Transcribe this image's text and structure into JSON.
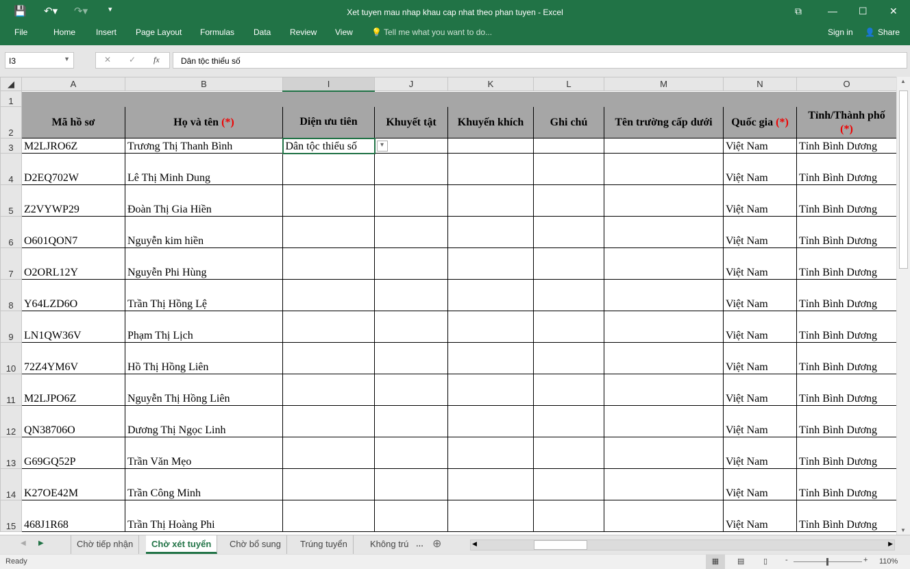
{
  "window": {
    "title": "Xet tuyen mau nhap khau cap nhat theo phan tuyen - Excel",
    "sign_in": "Sign in",
    "share": "Share"
  },
  "ribbon": {
    "tabs": [
      "File",
      "Home",
      "Insert",
      "Page Layout",
      "Formulas",
      "Data",
      "Review",
      "View"
    ],
    "tell_me": "Tell me what you want to do..."
  },
  "formula_bar": {
    "name_box": "I3",
    "fx": "fx",
    "value": "Dân tộc thiểu số"
  },
  "columns": [
    "A",
    "B",
    "I",
    "J",
    "K",
    "L",
    "M",
    "N",
    "O"
  ],
  "headers": {
    "a": "Mã hồ sơ",
    "b": "Họ và tên",
    "i": "Diện ưu tiên",
    "j": "Khuyết tật",
    "k": "Khuyến khích",
    "l": "Ghi chú",
    "m": "Tên trường cấp dưới",
    "n": "Quốc gia",
    "o": "Tỉnh/Thành phố",
    "star": "(*)"
  },
  "rows": [
    {
      "n": "3",
      "a": "M2LJRO6Z",
      "b": "Trương Thị Thanh Bình",
      "i": "Dân tộc thiểu số",
      "nat": "Việt Nam",
      "prov": "Tỉnh Bình Dương"
    },
    {
      "n": "4",
      "a": "D2EQ702W",
      "b": "Lê Thị Minh Dung",
      "i": "",
      "nat": "Việt Nam",
      "prov": "Tỉnh Bình Dương"
    },
    {
      "n": "5",
      "a": "Z2VYWP29",
      "b": "Đoàn Thị Gia Hiền",
      "i": "",
      "nat": "Việt Nam",
      "prov": "Tỉnh Bình Dương"
    },
    {
      "n": "6",
      "a": "O601QON7",
      "b": "Nguyễn kim hiền",
      "i": "",
      "nat": "Việt Nam",
      "prov": "Tỉnh Bình Dương"
    },
    {
      "n": "7",
      "a": "O2ORL12Y",
      "b": "Nguyễn Phi Hùng",
      "i": "",
      "nat": "Việt Nam",
      "prov": "Tỉnh Bình Dương"
    },
    {
      "n": "8",
      "a": "Y64LZD6O",
      "b": "Trần Thị Hồng Lệ",
      "i": "",
      "nat": "Việt Nam",
      "prov": "Tỉnh Bình Dương"
    },
    {
      "n": "9",
      "a": "LN1QW36V",
      "b": "Phạm Thị Lịch",
      "i": "",
      "nat": "Việt Nam",
      "prov": "Tỉnh Bình Dương"
    },
    {
      "n": "10",
      "a": "72Z4YM6V",
      "b": "Hồ Thị Hồng Liên",
      "i": "",
      "nat": "Việt Nam",
      "prov": "Tỉnh Bình Dương"
    },
    {
      "n": "11",
      "a": "M2LJPO6Z",
      "b": "Nguyễn Thị Hồng Liên",
      "i": "",
      "nat": "Việt Nam",
      "prov": "Tỉnh Bình Dương"
    },
    {
      "n": "12",
      "a": "QN38706O",
      "b": "Dương Thị Ngọc Linh",
      "i": "",
      "nat": "Việt Nam",
      "prov": "Tỉnh Bình Dương"
    },
    {
      "n": "13",
      "a": "G69GQ52P",
      "b": "Trần Văn Mẹo",
      "i": "",
      "nat": "Việt Nam",
      "prov": "Tỉnh Bình Dương"
    },
    {
      "n": "14",
      "a": "K27OE42M",
      "b": "Trần Công Minh",
      "i": "",
      "nat": "Việt Nam",
      "prov": "Tỉnh Bình Dương"
    },
    {
      "n": "15",
      "a": "468J1R68",
      "b": "Trần Thị Hoàng Phi",
      "i": "",
      "nat": "Việt Nam",
      "prov": "Tỉnh Bình Dương"
    }
  ],
  "sheets": [
    "Chờ tiếp nhận",
    "Chờ xét tuyển",
    "Chờ bổ sung",
    "Trúng tuyển",
    "Không trú"
  ],
  "active_sheet": 1,
  "more": "...",
  "status": {
    "ready": "Ready",
    "zoom": "110%"
  }
}
